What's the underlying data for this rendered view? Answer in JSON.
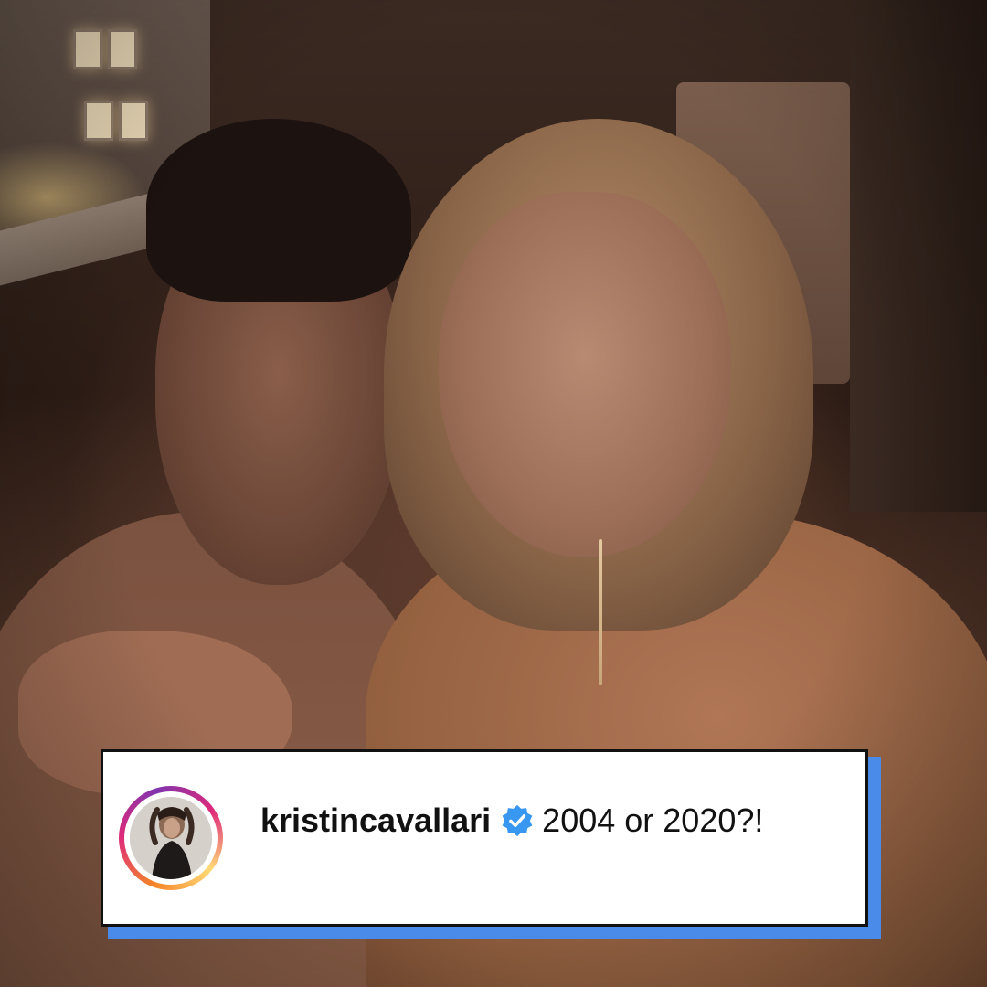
{
  "post": {
    "username": "kristincavallari",
    "verified": true,
    "caption": "2004 or 2020?!",
    "avatar_icon": "profile-avatar"
  },
  "colors": {
    "card_shadow": "#4a8ae8",
    "verified_badge": "#3897f0",
    "story_ring": [
      "#feda77",
      "#f58529",
      "#dd2a7b",
      "#8134af"
    ]
  }
}
